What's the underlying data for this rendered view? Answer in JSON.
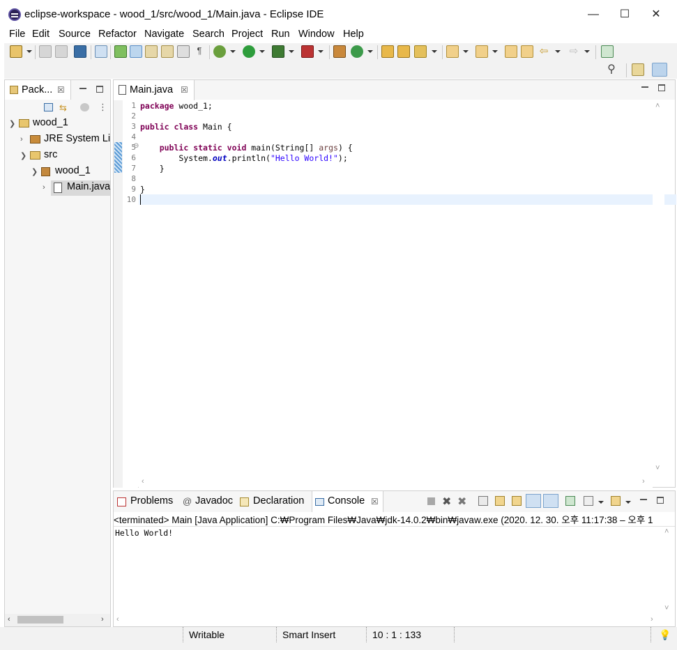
{
  "window": {
    "title": "eclipse-workspace - wood_1/src/wood_1/Main.java - Eclipse IDE",
    "minimize": "—",
    "maximize": "☐",
    "close": "✕"
  },
  "menu": [
    "File",
    "Edit",
    "Source",
    "Refactor",
    "Navigate",
    "Search",
    "Project",
    "Run",
    "Window",
    "Help"
  ],
  "package_explorer": {
    "tab_label": "Pack...",
    "close": "☒",
    "tree": {
      "project": "wood_1",
      "jre": "JRE System Lib",
      "src": "src",
      "package": "wood_1",
      "file": "Main.java"
    }
  },
  "editor": {
    "tab_label": "Main.java",
    "close": "☒",
    "line_numbers": [
      "1",
      "2",
      "3",
      "4",
      "5",
      "6",
      "7",
      "8",
      "9",
      "10"
    ],
    "code": {
      "l1_kw": "package",
      "l1_rest": " wood_1;",
      "l3_kw1": "public",
      "l3_kw2": "class",
      "l3_rest": " Main {",
      "l5_kw1": "public",
      "l5_kw2": "static",
      "l5_kw3": "void",
      "l5_mid": " main(String[] ",
      "l5_param": "args",
      "l5_end": ") {",
      "l6_start": "        System.",
      "l6_field": "out",
      "l6_mid": ".println(",
      "l6_str": "\"Hello World!\"",
      "l6_end": ");",
      "l7": "    }",
      "l9": "}"
    },
    "fold_marker": "⊖"
  },
  "console": {
    "tabs": {
      "problems": "Problems",
      "javadoc": "Javadoc",
      "declaration": "Declaration",
      "console": "Console"
    },
    "close": "☒",
    "header": "<terminated> Main [Java Application] C:₩Program Files₩Java₩jdk-14.0.2₩bin₩javaw.exe  (2020. 12. 30. 오후 11:17:38 – 오후 1",
    "output": "Hello World!"
  },
  "status_bar": {
    "writable": "Writable",
    "insert_mode": "Smart Insert",
    "position": "10 : 1 : 133"
  },
  "colors": {
    "keyword": "#7f0055",
    "string": "#2a00ff",
    "field": "#0000c0",
    "current_line": "#e8f2fe"
  }
}
